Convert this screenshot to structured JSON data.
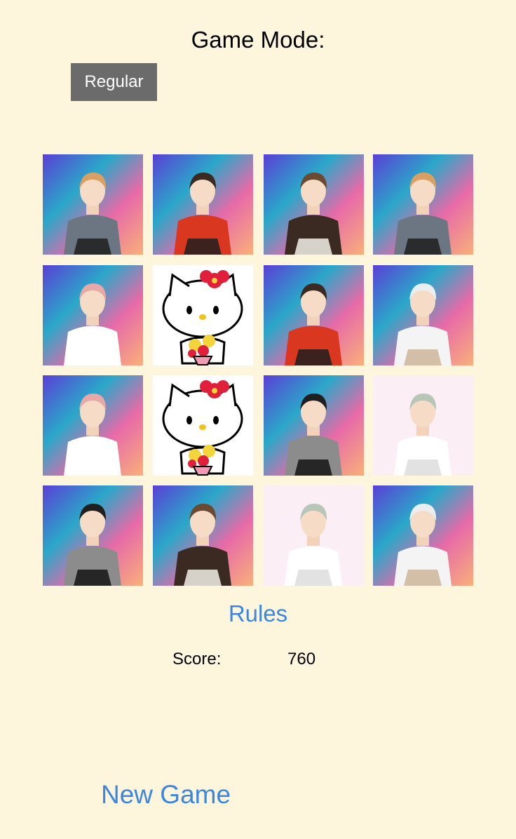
{
  "header": {
    "title": "Game Mode:"
  },
  "mode": {
    "label": "Regular"
  },
  "board": {
    "cards": [
      {
        "face": "member-a",
        "background": "gradient"
      },
      {
        "face": "member-b",
        "background": "gradient"
      },
      {
        "face": "member-c",
        "background": "gradient"
      },
      {
        "face": "member-a",
        "background": "gradient"
      },
      {
        "face": "member-d",
        "background": "gradient"
      },
      {
        "face": "hello-kitty",
        "background": "white"
      },
      {
        "face": "member-b",
        "background": "gradient"
      },
      {
        "face": "member-e",
        "background": "gradient"
      },
      {
        "face": "member-d",
        "background": "gradient"
      },
      {
        "face": "hello-kitty",
        "background": "white"
      },
      {
        "face": "member-f",
        "background": "gradient"
      },
      {
        "face": "member-g",
        "background": "pink"
      },
      {
        "face": "member-f",
        "background": "gradient"
      },
      {
        "face": "member-c",
        "background": "gradient"
      },
      {
        "face": "member-g",
        "background": "pink"
      },
      {
        "face": "member-e",
        "background": "gradient"
      }
    ]
  },
  "links": {
    "rules": "Rules",
    "new_game": "New Game"
  },
  "score": {
    "label": "Score:",
    "value": "760"
  }
}
